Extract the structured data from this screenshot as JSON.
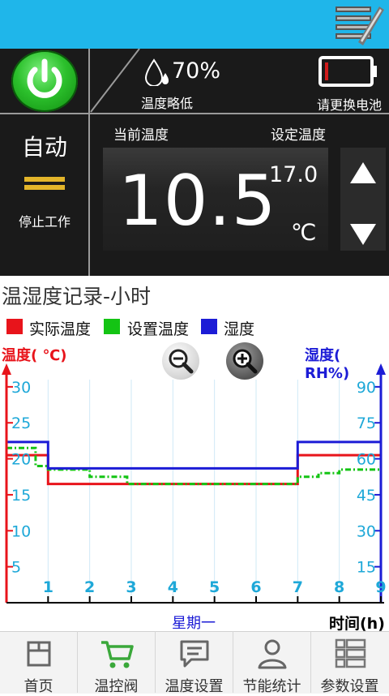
{
  "header": {
    "menu_icon": "menu-edit-icon"
  },
  "status_panel": {
    "power_icon": "power-icon",
    "humidity_value": "70%",
    "humidity_label": "温度略低",
    "battery_label": "请更换电池",
    "mode_label": "自动",
    "status_label": "停止工作",
    "current_temp_label": "当前温度",
    "set_temp_label": "设定温度",
    "current_temp_value": "10.5",
    "set_temp_value": "17.0",
    "unit": "℃",
    "colors": {
      "bar": "#1fb6ea",
      "panel": "#1a1a1a",
      "power": "#2cc02c",
      "battery": "#d01b1b",
      "mode_bars": "#e3b52a"
    }
  },
  "chart_section": {
    "title": "温湿度记录-小时",
    "legend": [
      {
        "label": "实际温度",
        "color": "#e8141b"
      },
      {
        "label": "设置温度",
        "color": "#14c414"
      },
      {
        "label": "湿度",
        "color": "#1c1cd6"
      }
    ],
    "left_axis_title": "温度( ℃)",
    "right_axis_title": "湿度( RH%)",
    "zoom_out_icon": "zoom-out-icon",
    "zoom_in_icon": "zoom-in-icon",
    "day_label": "星期一",
    "time_label": "时间(h)"
  },
  "chart_data": {
    "type": "line",
    "x_ticks": [
      "1",
      "2",
      "3",
      "4",
      "5",
      "6",
      "7",
      "8",
      "9"
    ],
    "y_left_ticks": [
      "5",
      "10",
      "15",
      "20",
      "25",
      "30"
    ],
    "y_right_ticks": [
      "15",
      "30",
      "45",
      "60",
      "75",
      "90"
    ],
    "ylim_left": [
      0,
      31
    ],
    "ylim_right": [
      0,
      93
    ],
    "xlim": [
      0,
      9
    ],
    "series": [
      {
        "name": "实际温度",
        "axis": "left",
        "color": "#e8141b",
        "style": "solid",
        "points": [
          [
            0,
            20.5
          ],
          [
            1,
            20.5
          ],
          [
            1,
            16.5
          ],
          [
            7,
            16.5
          ],
          [
            7,
            20.5
          ],
          [
            9,
            20.5
          ]
        ]
      },
      {
        "name": "设置温度",
        "axis": "left",
        "color": "#14c414",
        "style": "dashed",
        "points": [
          [
            0,
            21.5
          ],
          [
            0.7,
            21.5
          ],
          [
            0.7,
            19
          ],
          [
            1,
            19
          ],
          [
            1,
            18.5
          ],
          [
            2,
            18.5
          ],
          [
            2,
            17.5
          ],
          [
            2.9,
            17.5
          ],
          [
            2.9,
            16.5
          ],
          [
            7,
            16.5
          ],
          [
            7,
            17.5
          ],
          [
            7.5,
            17.5
          ],
          [
            7.5,
            18
          ],
          [
            8,
            18
          ],
          [
            8,
            18.5
          ],
          [
            9,
            18.5
          ]
        ]
      },
      {
        "name": "湿度",
        "axis": "right",
        "color": "#1c1cd6",
        "style": "solid",
        "points": [
          [
            0,
            67
          ],
          [
            1,
            67
          ],
          [
            1,
            56
          ],
          [
            7,
            56
          ],
          [
            7,
            67
          ],
          [
            9,
            67
          ]
        ]
      }
    ]
  },
  "navbar": {
    "items": [
      {
        "label": "首页",
        "icon": "home-icon"
      },
      {
        "label": "温控阀",
        "icon": "cart-icon",
        "active": true
      },
      {
        "label": "温度设置",
        "icon": "message-icon"
      },
      {
        "label": "节能统计",
        "icon": "user-icon"
      },
      {
        "label": "参数设置",
        "icon": "list-icon"
      }
    ]
  }
}
